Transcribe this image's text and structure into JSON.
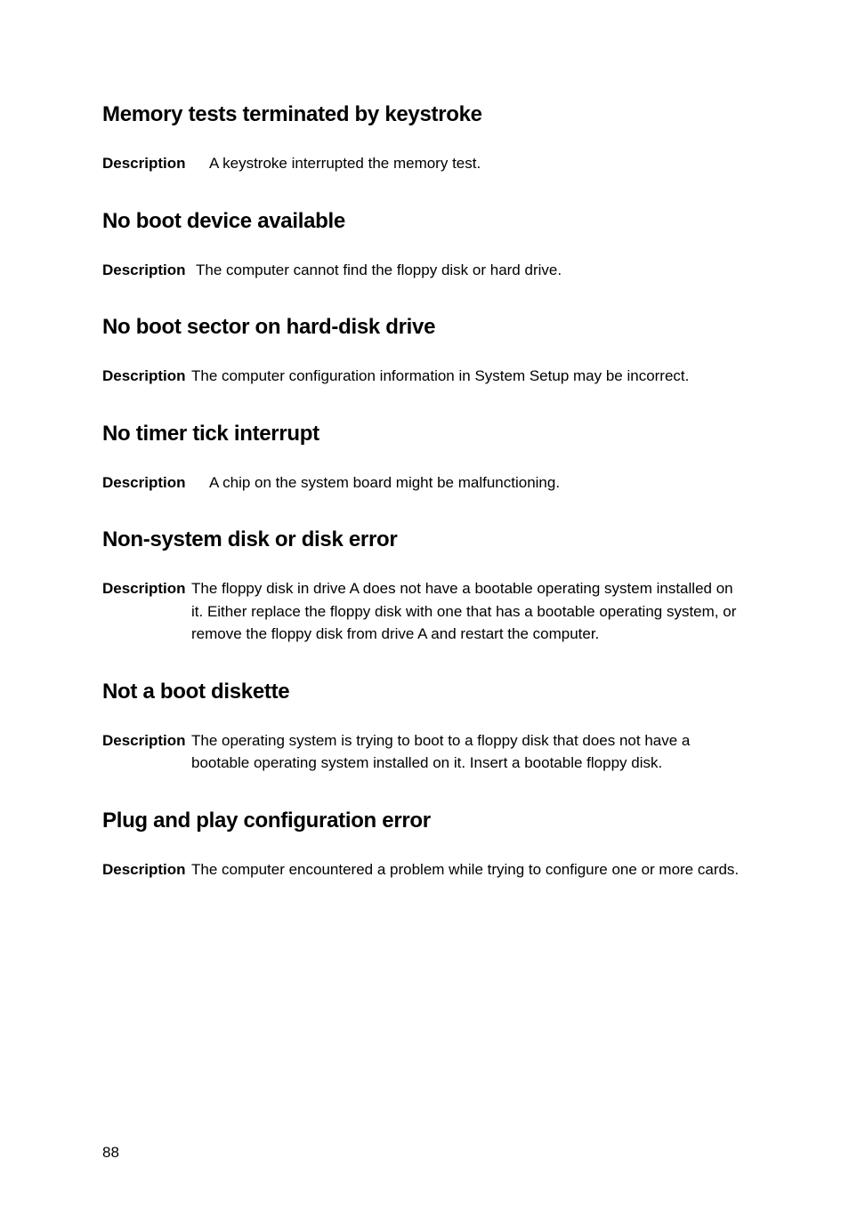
{
  "sections": [
    {
      "heading": "Memory tests terminated by keystroke",
      "label": "Description",
      "text": "A keystroke interrupted the memory test.",
      "labelWidth": "w1"
    },
    {
      "heading": "No boot device available",
      "label": "Description",
      "text": "The computer cannot find the floppy disk or hard drive.",
      "labelWidth": "w2"
    },
    {
      "heading": "No boot sector on hard-disk drive",
      "label": "Description",
      "text": "The computer configuration information in System Setup may be incorrect.",
      "labelWidth": "w3"
    },
    {
      "heading": "No timer tick interrupt",
      "label": "Description",
      "text": "A chip on the system board might be malfunctioning.",
      "labelWidth": "w1"
    },
    {
      "heading": "Non-system disk or disk error",
      "label": "Description",
      "text": "The floppy disk in drive A does not have a bootable operating system installed on it. Either replace the floppy disk with one that has a bootable operating system, or remove the floppy disk from drive A and restart the computer.",
      "labelWidth": "w3"
    },
    {
      "heading": "Not a boot diskette",
      "label": "Description",
      "text": "The operating system is trying to boot to a floppy disk that does not have a bootable operating system installed on it. Insert a bootable floppy disk.",
      "labelWidth": "w3"
    },
    {
      "heading": "Plug and play configuration error",
      "label": "Description",
      "text": "The computer encountered a problem while trying to configure one or more cards.",
      "labelWidth": "w3"
    }
  ],
  "pageNumber": "88"
}
